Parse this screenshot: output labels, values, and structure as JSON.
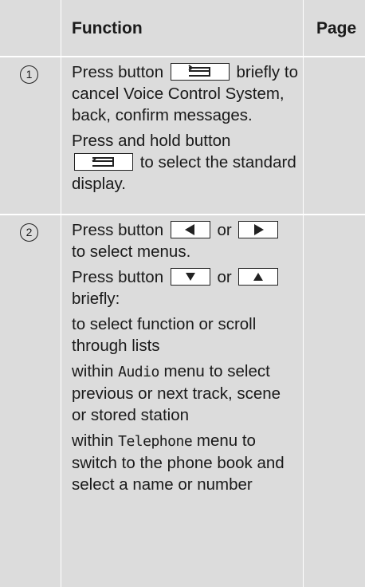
{
  "header": {
    "function_label": "Function",
    "page_label": "Page"
  },
  "rows": [
    {
      "number": "1",
      "paragraphs": [
        {
          "before": "Press button",
          "key1_icon": "back-key-icon",
          "after": "briefly to cancel Voice Control System, back, confirm messages."
        },
        {
          "before": "Press and hold button",
          "key1_icon": "back-key-icon",
          "after": "to select the standard display."
        }
      ]
    },
    {
      "number": "2",
      "paragraphs": [
        {
          "before": "Press button",
          "key1_icon": "left-key-icon",
          "middle": "or",
          "key2_icon": "right-key-icon",
          "after": "to select menus."
        },
        {
          "before": "Press button",
          "key1_icon": "down-key-icon",
          "middle": "or",
          "key2_icon": "up-key-icon",
          "after": "briefly:"
        },
        {
          "text": "to select function or scroll through lists"
        },
        {
          "prefix": "within",
          "code": "Audio",
          "suffix": "menu to select previous or next track, scene or stored station"
        },
        {
          "prefix": "within",
          "code": "Telephone",
          "suffix": "menu to switch to the phone book and select a name or number"
        }
      ]
    }
  ]
}
